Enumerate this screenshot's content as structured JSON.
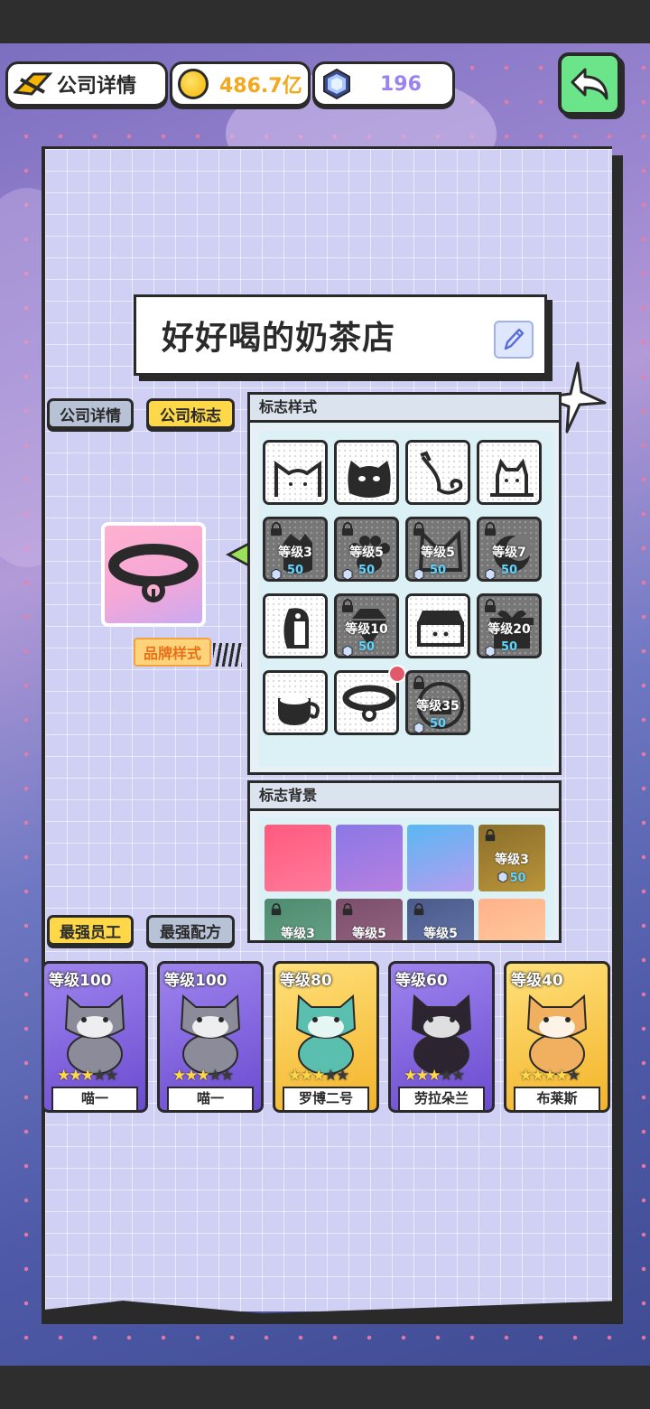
{
  "header": {
    "company_label": "公司详情",
    "coins": "486.7亿",
    "gems": "196"
  },
  "company_name": "好好喝的奶茶店",
  "tabs": {
    "company_details": "公司详情",
    "company_logo": "公司标志"
  },
  "brand_style_label": "品牌样式",
  "logo_style": {
    "title": "标志样式",
    "rows": [
      [
        {
          "icon": "cat-ears-icon",
          "locked": false
        },
        {
          "icon": "cat-face-icon",
          "locked": false
        },
        {
          "icon": "cat-swirl-icon",
          "locked": false
        },
        {
          "icon": "cat-box-icon",
          "locked": false
        }
      ],
      [
        {
          "icon": "cat-coffee-icon",
          "locked": true,
          "level": "等级3",
          "cost": "50"
        },
        {
          "icon": "paw-icon",
          "locked": true,
          "level": "等级5",
          "cost": "50"
        },
        {
          "icon": "cat-head-icon",
          "locked": true,
          "level": "等级5",
          "cost": "50"
        },
        {
          "icon": "cat-moon-icon",
          "locked": true,
          "level": "等级7",
          "cost": "50"
        }
      ],
      [
        {
          "icon": "penguin-scroll-icon",
          "locked": false
        },
        {
          "icon": "diamond-icon",
          "locked": true,
          "level": "等级10",
          "cost": "50"
        },
        {
          "icon": "cat-shop-icon",
          "locked": false
        },
        {
          "icon": "gift-icon",
          "locked": true,
          "level": "等级20",
          "cost": "50"
        }
      ],
      [
        {
          "icon": "coffee-cup-icon",
          "locked": false
        },
        {
          "icon": "collar-icon",
          "locked": false,
          "selected": true
        },
        {
          "icon": "cat-coin-icon",
          "locked": true,
          "level": "等级35",
          "cost": "50"
        }
      ]
    ]
  },
  "logo_background": {
    "title": "标志背景",
    "swatches": [
      {
        "colors": [
          "#ff5a7e",
          "#ff7a9a"
        ],
        "locked": false
      },
      {
        "colors": [
          "#8a78e6",
          "#b77fe0"
        ],
        "locked": false
      },
      {
        "colors": [
          "#58b8f2",
          "#b69cf0"
        ],
        "locked": false
      },
      {
        "colors": [
          "#8a6e2a",
          "#b9943a"
        ],
        "locked": true,
        "level": "等级3",
        "cost": "50"
      }
    ],
    "row2": [
      {
        "colors": [
          "#4e8a6f",
          "#6aa88a"
        ],
        "locked": true,
        "level": "等级3"
      },
      {
        "colors": [
          "#7a4e6a",
          "#9c6a8a"
        ],
        "locked": true,
        "level": "等级5"
      },
      {
        "colors": [
          "#4a5a8a",
          "#6a7ab0"
        ],
        "locked": true,
        "level": "等级5"
      },
      {
        "colors": [
          "#ffb18a",
          "#ffd0a0"
        ],
        "locked": false
      }
    ]
  },
  "bottom_tabs": {
    "strongest_staff": "最强员工",
    "strongest_recipe": "最强配方"
  },
  "staff": [
    {
      "level": "等级100",
      "stars": 3,
      "name": "喵一",
      "theme": "purple",
      "fur": "#8b8b9a"
    },
    {
      "level": "等级100",
      "stars": 3,
      "name": "喵一",
      "theme": "purple",
      "fur": "#8b8b9a"
    },
    {
      "level": "等级80",
      "stars": 3,
      "name": "罗博二号",
      "theme": "gold",
      "fur": "#5bbfb0"
    },
    {
      "level": "等级60",
      "stars": 3,
      "name": "劳拉朵兰",
      "theme": "purple",
      "fur": "#2c2430"
    },
    {
      "level": "等级40",
      "stars": 4,
      "name": "布莱斯",
      "theme": "gold",
      "fur": "#f0b060"
    }
  ]
}
